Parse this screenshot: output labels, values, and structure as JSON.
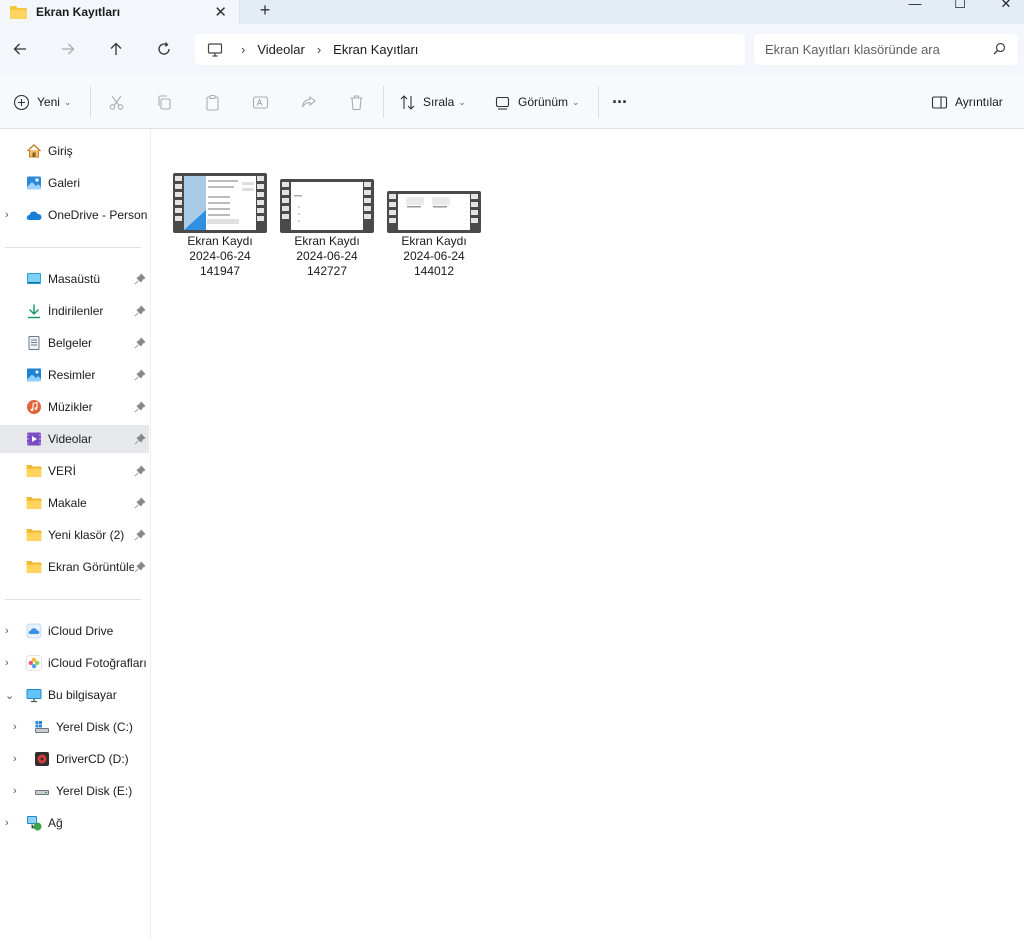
{
  "window": {
    "tab_title": "Ekran Kayıtları",
    "tab_close": "✕",
    "new_tab": "+",
    "minimize": "—",
    "maximize": "☐",
    "close": "✕"
  },
  "address": {
    "crumbs": [
      "Videolar",
      "Ekran Kayıtları"
    ],
    "separator": "›"
  },
  "search": {
    "placeholder": "Ekran Kayıtları klasöründe ara"
  },
  "toolbar": {
    "new_label": "Yeni",
    "sort_label": "Sırala",
    "view_label": "Görünüm",
    "more_label": "···",
    "details_label": "Ayrıntılar"
  },
  "sidebar": {
    "top": [
      {
        "label": "Giriş",
        "icon": "home-icon"
      },
      {
        "label": "Galeri",
        "icon": "gallery-icon"
      },
      {
        "label": "OneDrive - Persona",
        "icon": "onedrive-icon"
      }
    ],
    "quick": [
      {
        "label": "Masaüstü",
        "icon": "desktop-icon"
      },
      {
        "label": "İndirilenler",
        "icon": "download-icon"
      },
      {
        "label": "Belgeler",
        "icon": "documents-icon"
      },
      {
        "label": "Resimler",
        "icon": "pictures-icon"
      },
      {
        "label": "Müzikler",
        "icon": "music-icon"
      },
      {
        "label": "Videolar",
        "icon": "videos-icon"
      },
      {
        "label": "VERİ",
        "icon": "folder-icon"
      },
      {
        "label": "Makale",
        "icon": "folder-icon"
      },
      {
        "label": "Yeni klasör (2)",
        "icon": "folder-icon"
      },
      {
        "label": "Ekran Görüntüle",
        "icon": "folder-icon"
      }
    ],
    "devices": [
      {
        "label": "iCloud Drive",
        "icon": "icloud-drive-icon"
      },
      {
        "label": "iCloud Fotoğrafları",
        "icon": "icloud-photos-icon"
      },
      {
        "label": "Bu bilgisayar",
        "icon": "this-pc-icon"
      },
      {
        "label": "Yerel Disk (C:)",
        "icon": "disk-c-icon"
      },
      {
        "label": "DriverCD (D:)",
        "icon": "drivercd-icon"
      },
      {
        "label": "Yerel Disk (E:)",
        "icon": "disk-e-icon"
      },
      {
        "label": "Ağ",
        "icon": "network-icon"
      }
    ]
  },
  "files": [
    {
      "name": "Ekran Kaydı 2024-06-24 141947"
    },
    {
      "name": "Ekran Kaydı 2024-06-24 142727"
    },
    {
      "name": "Ekran Kaydı 2024-06-24 144012"
    }
  ],
  "colors": {
    "titlebar": "#e4ecf6",
    "addressbar": "#f3f7fb",
    "selected": "#e6e8ec",
    "folder": "#f8c43a",
    "accent": "#0f6cbd"
  }
}
